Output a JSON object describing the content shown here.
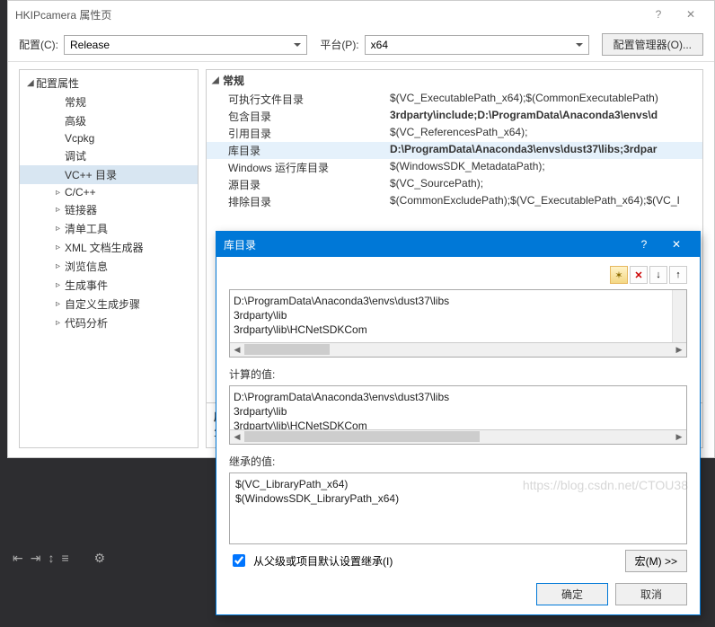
{
  "main": {
    "title": "HKIPcamera 属性页",
    "config_label": "配置(C):",
    "config_value": "Release",
    "platform_label": "平台(P):",
    "platform_value": "x64",
    "config_manager_btn": "配置管理器(O)..."
  },
  "tree": {
    "root": "配置属性",
    "items": [
      {
        "label": "常规",
        "arrow": ""
      },
      {
        "label": "高级",
        "arrow": ""
      },
      {
        "label": "Vcpkg",
        "arrow": ""
      },
      {
        "label": "调试",
        "arrow": ""
      },
      {
        "label": "VC++ 目录",
        "arrow": "",
        "selected": true
      },
      {
        "label": "C/C++",
        "arrow": "▹"
      },
      {
        "label": "链接器",
        "arrow": "▹"
      },
      {
        "label": "清单工具",
        "arrow": "▹"
      },
      {
        "label": "XML 文档生成器",
        "arrow": "▹"
      },
      {
        "label": "浏览信息",
        "arrow": "▹"
      },
      {
        "label": "生成事件",
        "arrow": "▹"
      },
      {
        "label": "自定义生成步骤",
        "arrow": "▹"
      },
      {
        "label": "代码分析",
        "arrow": "▹"
      }
    ]
  },
  "props": {
    "category": "常规",
    "rows": [
      {
        "name": "可执行文件目录",
        "value": "$(VC_ExecutablePath_x64);$(CommonExecutablePath)",
        "bold": false
      },
      {
        "name": "包含目录",
        "value": "3rdparty\\include;D:\\ProgramData\\Anaconda3\\envs\\d",
        "bold": true
      },
      {
        "name": "引用目录",
        "value": "$(VC_ReferencesPath_x64);",
        "bold": false
      },
      {
        "name": "库目录",
        "value": "D:\\ProgramData\\Anaconda3\\envs\\dust37\\libs;3rdpar",
        "bold": true,
        "selected": true
      },
      {
        "name": "Windows 运行库目录",
        "value": "$(WindowsSDK_MetadataPath);",
        "bold": false
      },
      {
        "name": "源目录",
        "value": "$(VC_SourcePath);",
        "bold": false
      },
      {
        "name": "排除目录",
        "value": "$(CommonExcludePath);$(VC_ExecutablePath_x64);$(VC_I",
        "bold": false
      }
    ],
    "desc_title": "库目",
    "desc_text": "生成"
  },
  "dialog": {
    "title": "库目录",
    "entries": [
      "D:\\ProgramData\\Anaconda3\\envs\\dust37\\libs",
      "3rdparty\\lib",
      "3rdparty\\lib\\HCNetSDKCom"
    ],
    "computed_label": "计算的值:",
    "computed": [
      "D:\\ProgramData\\Anaconda3\\envs\\dust37\\libs",
      "3rdparty\\lib",
      "3rdparty\\lib\\HCNetSDKCom"
    ],
    "inherited_label": "继承的值:",
    "inherited": [
      "$(VC_LibraryPath_x64)",
      "$(WindowsSDK_LibraryPath_x64)"
    ],
    "inherit_checkbox": "从父级或项目默认设置继承(I)",
    "macro_btn": "宏(M) >>",
    "ok": "确定",
    "cancel": "取消"
  },
  "watermark": "https://blog.csdn.net/CTOU38"
}
